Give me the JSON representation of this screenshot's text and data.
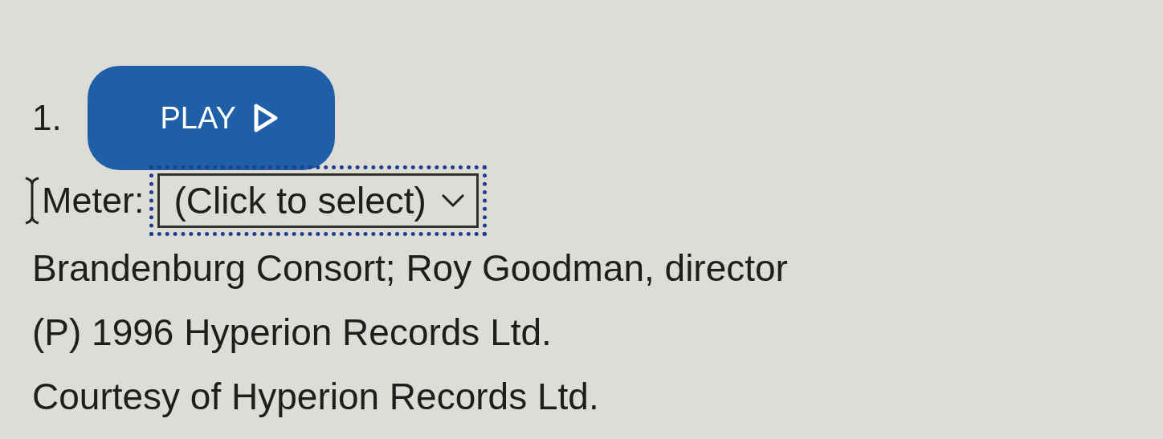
{
  "item_number": "1.",
  "play_button": {
    "label": "PLAY"
  },
  "meter": {
    "label": "Meter:",
    "select": {
      "value": "(Click to select)",
      "focused": true
    }
  },
  "credits": [
    "Brandenburg Consort; Roy Goodman, director",
    "(P) 1996 Hyperion Records Ltd.",
    "Courtesy of Hyperion Records Ltd."
  ]
}
